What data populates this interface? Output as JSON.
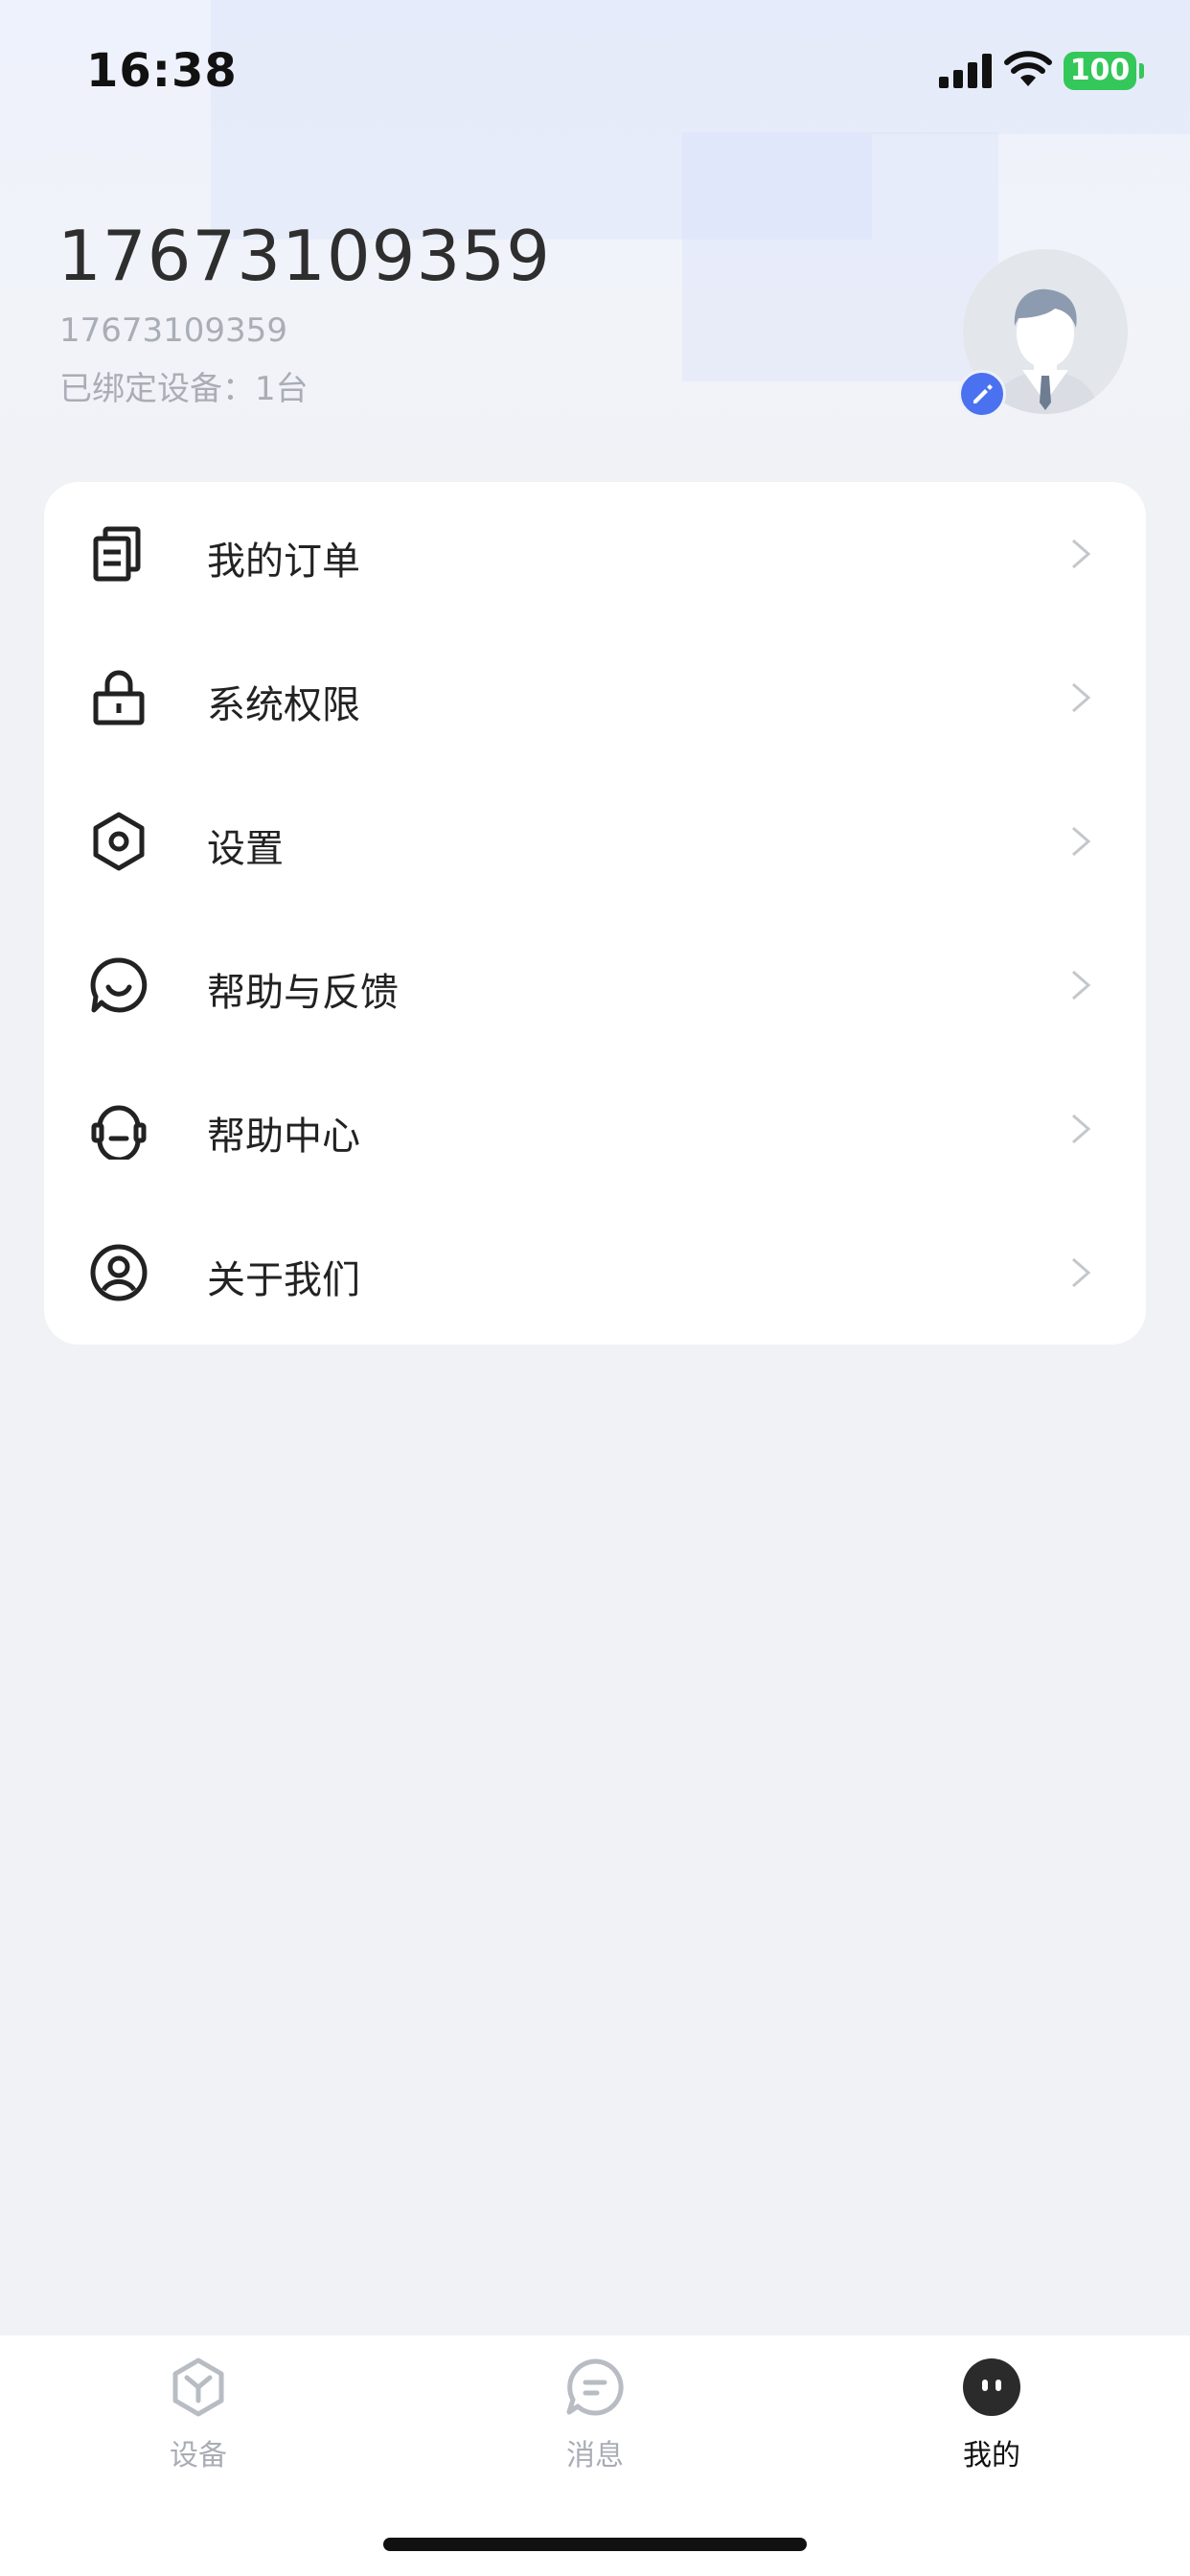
{
  "status_bar": {
    "time": "16:38",
    "battery": "100",
    "icons": [
      "signal-icon",
      "wifi-icon",
      "battery-icon"
    ]
  },
  "profile": {
    "name": "17673109359",
    "phone": "17673109359",
    "devices_text": "已绑定设备：1台",
    "avatar_icon": "avatar-default-icon",
    "edit_icon": "pencil-icon"
  },
  "menu": {
    "items": [
      {
        "label": "我的订单",
        "icon": "orders-icon"
      },
      {
        "label": "系统权限",
        "icon": "lock-icon"
      },
      {
        "label": "设置",
        "icon": "settings-hex-icon"
      },
      {
        "label": "帮助与反馈",
        "icon": "feedback-chat-icon"
      },
      {
        "label": "帮助中心",
        "icon": "headset-icon"
      },
      {
        "label": "关于我们",
        "icon": "user-circle-icon"
      }
    ]
  },
  "tabs": [
    {
      "label": "设备",
      "icon": "device-cube-icon",
      "active": false
    },
    {
      "label": "消息",
      "icon": "message-icon",
      "active": false
    },
    {
      "label": "我的",
      "icon": "profile-face-icon",
      "active": true
    }
  ],
  "colors": {
    "accent": "#4a72f0",
    "battery": "#34c759",
    "text_primary": "#222222",
    "text_secondary": "#a9adb5",
    "background": "#f1f2f5"
  }
}
